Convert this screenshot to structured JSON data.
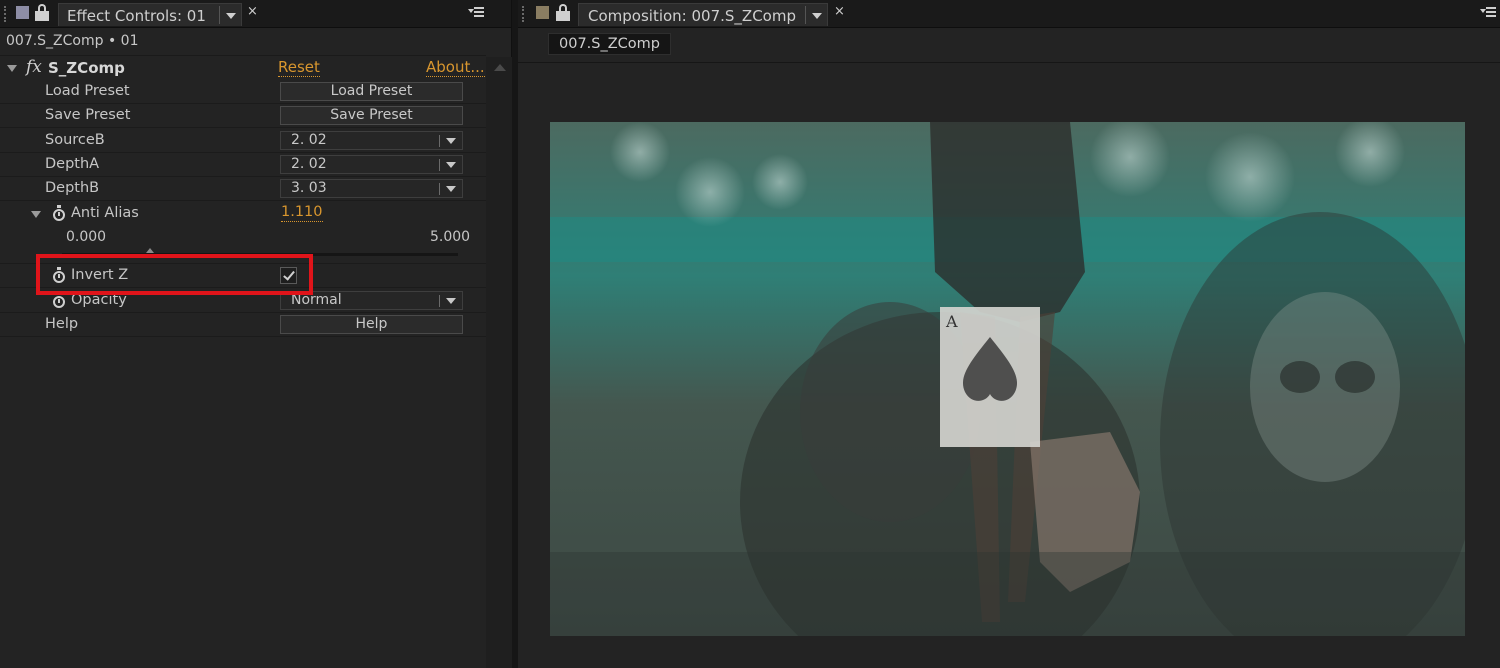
{
  "effect_controls": {
    "tab_title": "Effect Controls: 01",
    "breadcrumb": "007.S_ZComp • 01",
    "effect_name": "S_ZComp",
    "reset_label": "Reset",
    "about_label": "About...",
    "rows": {
      "load_preset": {
        "label": "Load Preset",
        "button": "Load Preset"
      },
      "save_preset": {
        "label": "Save Preset",
        "button": "Save Preset"
      },
      "source_b": {
        "label": "SourceB",
        "value": "2. 02"
      },
      "depth_a": {
        "label": "DepthA",
        "value": "2. 02"
      },
      "depth_b": {
        "label": "DepthB",
        "value": "3. 03"
      },
      "anti_alias": {
        "label": "Anti Alias",
        "value": "1.110",
        "slider_min": "0.000",
        "slider_max": "5.000",
        "slider_fraction": 0.222
      },
      "invert_z": {
        "label": "Invert Z",
        "checked": true
      },
      "opacity": {
        "label": "Opacity",
        "value": "Normal"
      },
      "help": {
        "label": "Help",
        "button": "Help"
      }
    },
    "highlight_color": "#e0141a",
    "accent_color": "#d8962e"
  },
  "composition": {
    "tab_title": "Composition: 007.S_ZComp",
    "subtab": "007.S_ZComp",
    "swatch_color": "#8a7d62"
  },
  "icons": {
    "close": "×",
    "left_swatch_color": "#8e8ea6"
  }
}
